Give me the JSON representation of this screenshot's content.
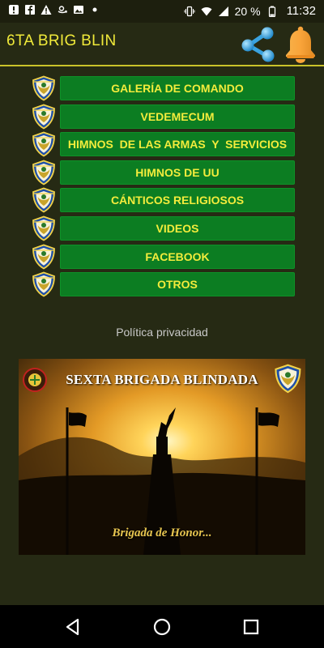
{
  "status_bar": {
    "left_icons": [
      "alert-icon",
      "facebook-icon",
      "warning-icon",
      "amazon-icon",
      "image-icon",
      "dot-icon"
    ],
    "right_icons": [
      "vibrate-icon",
      "wifi-icon",
      "signal-icon",
      "battery-icon"
    ],
    "battery": "20 %",
    "time": "11:32"
  },
  "toolbar": {
    "title": "6TA BRIG BLIN",
    "share_icon": "share-icon",
    "bell_icon": "bell-icon"
  },
  "menu": {
    "items": [
      {
        "label": "GALERÍA DE COMANDO"
      },
      {
        "label": "VEDEMECUM"
      },
      {
        "label": "HIMNOS  DE LAS ARMAS  Y  SERVICIOS"
      },
      {
        "label": "HIMNOS DE UU"
      },
      {
        "label": "CÁNTICOS RELIGIOSOS"
      },
      {
        "label": "VIDEOS"
      },
      {
        "label": "FACEBOOK"
      },
      {
        "label": "OTROS"
      }
    ],
    "badge_icon": "brigade-shield-icon"
  },
  "privacy_link": "Política privacidad",
  "banner": {
    "title": "SEXTA BRIGADA BLINDADA",
    "motto": "Brigada de Honor..."
  },
  "colors": {
    "background": "#262a14",
    "accent_yellow": "#f0ea3a",
    "button_green": "#0c7d22"
  },
  "nav_bar": {
    "back_icon": "back-icon",
    "home_icon": "home-icon",
    "recents_icon": "recents-icon"
  }
}
